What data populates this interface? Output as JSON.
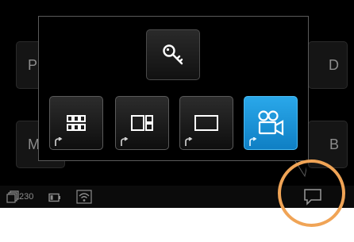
{
  "background_tiles": {
    "p_label": "P",
    "m_label": "M",
    "d_label": "D",
    "b_label": "B"
  },
  "popup": {
    "key_icon": "key-icon",
    "layouts": [
      {
        "icon": "grid-3x2-icon",
        "active": false
      },
      {
        "icon": "split-layout-icon",
        "active": false
      },
      {
        "icon": "single-layout-icon",
        "active": false
      },
      {
        "icon": "video-camera-icon",
        "active": true
      }
    ]
  },
  "status_bar": {
    "count": "230",
    "icons": [
      "layers-icon",
      "battery-icon",
      "wifi-icon"
    ],
    "chat_icon": "chat-bubble-icon"
  },
  "colors": {
    "accent": "#1a95d9",
    "highlight_ring": "#f0a456",
    "icon": "#ffffff",
    "muted": "#8d8d8d"
  }
}
